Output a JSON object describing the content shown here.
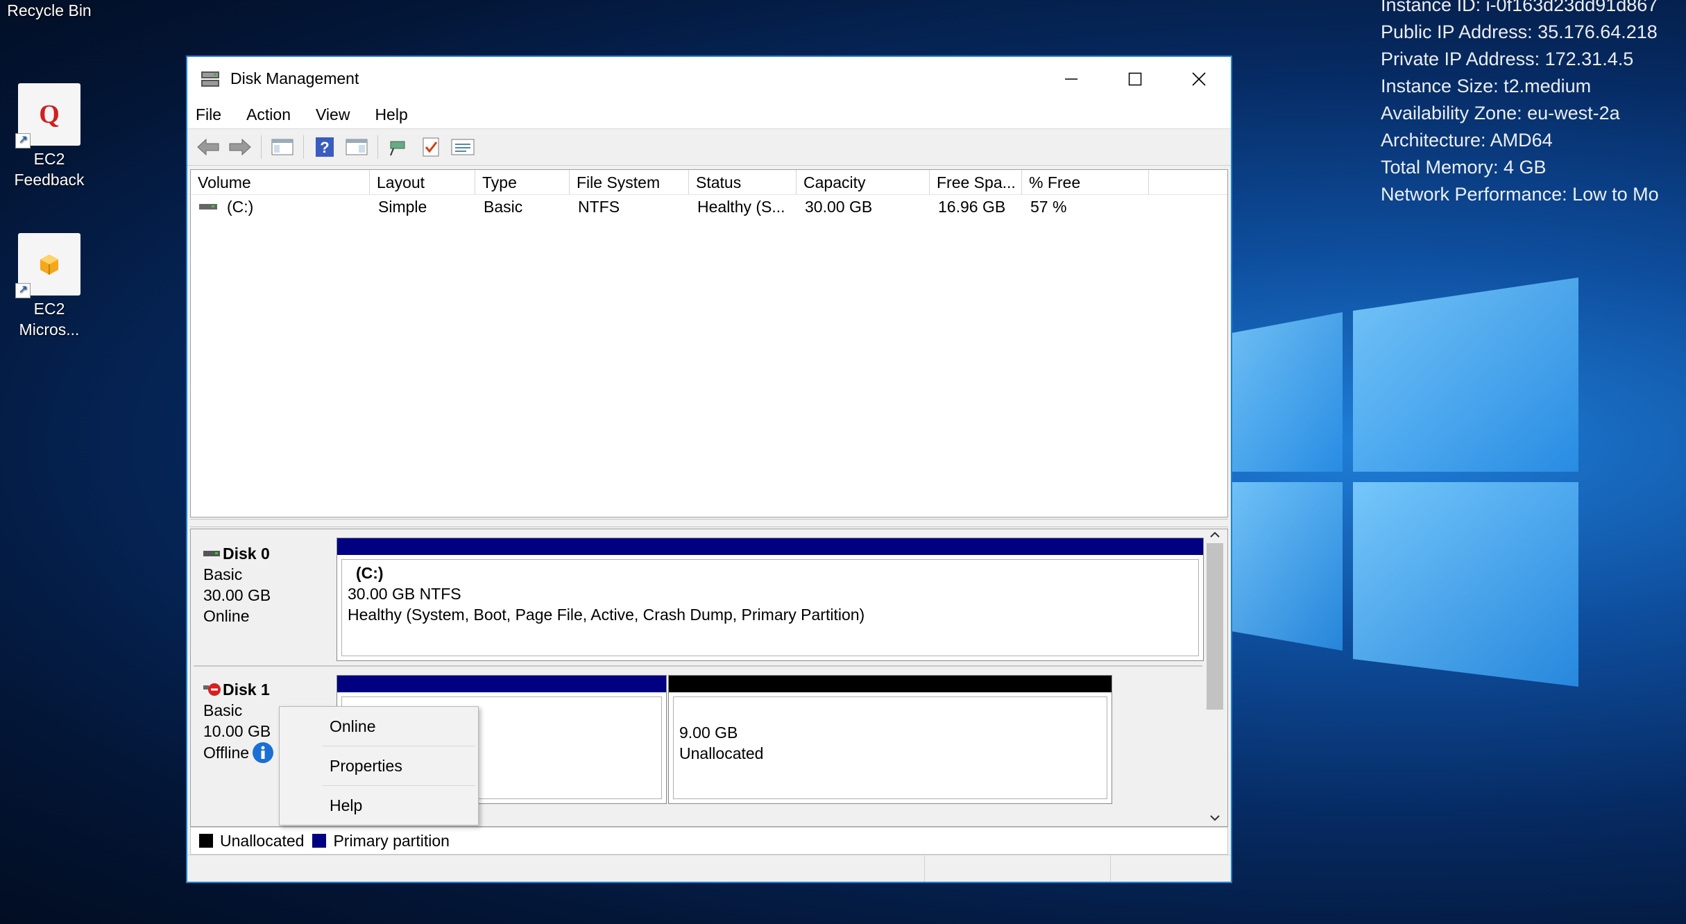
{
  "desktop": {
    "icons": [
      {
        "label": "Recycle Bin"
      },
      {
        "label": "EC2 Feedback"
      },
      {
        "label": "EC2 Micros..."
      }
    ],
    "sysinfo": [
      "Instance ID: i-0f163d23dd91d867",
      "Public IP Address: 35.176.64.218",
      "Private IP Address: 172.31.4.5",
      "Instance Size: t2.medium",
      "Availability Zone: eu-west-2a",
      "Architecture: AMD64",
      "Total Memory: 4 GB",
      "Network Performance: Low to Mo"
    ]
  },
  "window": {
    "title": "Disk Management",
    "menu": [
      "File",
      "Action",
      "View",
      "Help"
    ]
  },
  "volume_list": {
    "columns": [
      "Volume",
      "Layout",
      "Type",
      "File System",
      "Status",
      "Capacity",
      "Free Spa...",
      "% Free"
    ],
    "rows": [
      {
        "volume": "(C:)",
        "layout": "Simple",
        "type": "Basic",
        "file_system": "NTFS",
        "status": "Healthy (S...",
        "capacity": "30.00 GB",
        "free_space": "16.96 GB",
        "pct_free": "57 %"
      }
    ]
  },
  "disks": [
    {
      "name": "Disk 0",
      "type": "Basic",
      "size": "30.00 GB",
      "state": "Online",
      "partition": {
        "name": "(C:)",
        "size_fs": "30.00 GB NTFS",
        "status": "Healthy (System, Boot, Page File, Active, Crash Dump, Primary Partition)"
      }
    },
    {
      "name": "Disk 1",
      "type": "Basic",
      "size": "10.00 GB",
      "state": "Offline",
      "unallocated": {
        "size": "9.00 GB",
        "label": "Unallocated"
      }
    }
  ],
  "legend": {
    "unallocated": "Unallocated",
    "primary": "Primary partition"
  },
  "context_menu": [
    "Online",
    "Properties",
    "Help"
  ],
  "colors": {
    "primary_partition": "#000080",
    "unallocated": "#000000",
    "window_border": "#1e82d8"
  }
}
